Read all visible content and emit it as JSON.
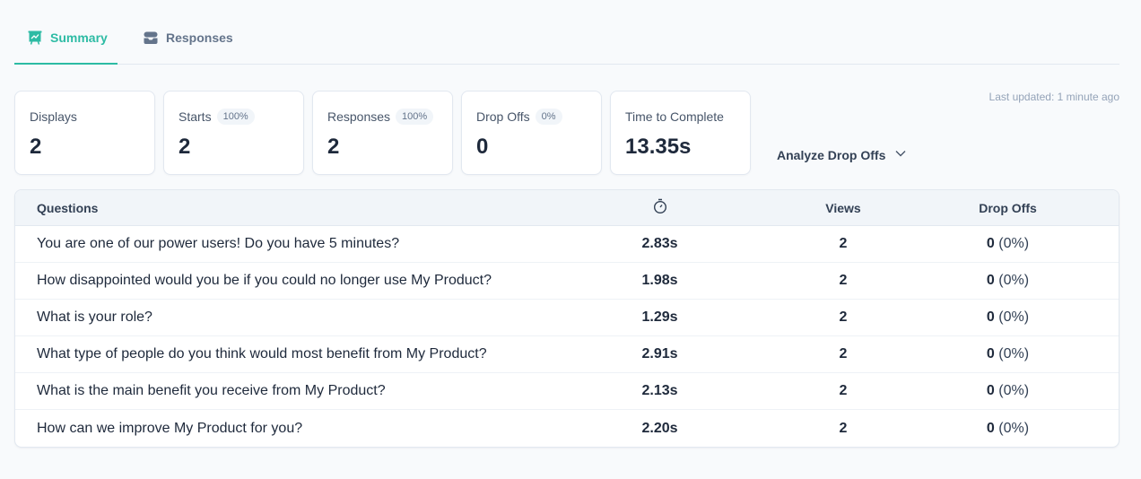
{
  "tabs": [
    {
      "label": "Summary",
      "icon": "presentation-chart-icon",
      "active": true
    },
    {
      "label": "Responses",
      "icon": "inbox-stack-icon",
      "active": false
    }
  ],
  "stats": [
    {
      "label": "Displays",
      "badge": null,
      "value": "2"
    },
    {
      "label": "Starts",
      "badge": "100%",
      "value": "2"
    },
    {
      "label": "Responses",
      "badge": "100%",
      "value": "2"
    },
    {
      "label": "Drop Offs",
      "badge": "0%",
      "value": "0"
    },
    {
      "label": "Time to Complete",
      "badge": null,
      "value": "13.35s"
    }
  ],
  "analyze_label": "Analyze Drop Offs",
  "last_updated": "Last updated: 1 minute ago",
  "table": {
    "headers": {
      "questions": "Questions",
      "time_icon": "stopwatch-icon",
      "views": "Views",
      "drop_offs": "Drop Offs"
    },
    "rows": [
      {
        "question": "You are one of our power users! Do you have 5 minutes?",
        "time": "2.83s",
        "views": "2",
        "drop_count": "0",
        "drop_pct": "(0%)"
      },
      {
        "question": "How disappointed would you be if you could no longer use My Product?",
        "time": "1.98s",
        "views": "2",
        "drop_count": "0",
        "drop_pct": "(0%)"
      },
      {
        "question": "What is your role?",
        "time": "1.29s",
        "views": "2",
        "drop_count": "0",
        "drop_pct": "(0%)"
      },
      {
        "question": "What type of people do you think would most benefit from My Product?",
        "time": "2.91s",
        "views": "2",
        "drop_count": "0",
        "drop_pct": "(0%)"
      },
      {
        "question": "What is the main benefit you receive from My Product?",
        "time": "2.13s",
        "views": "2",
        "drop_count": "0",
        "drop_pct": "(0%)"
      },
      {
        "question": "How can we improve My Product for you?",
        "time": "2.20s",
        "views": "2",
        "drop_count": "0",
        "drop_pct": "(0%)"
      }
    ]
  },
  "colors": {
    "accent": "#2dbba4",
    "muted": "#64748b"
  }
}
